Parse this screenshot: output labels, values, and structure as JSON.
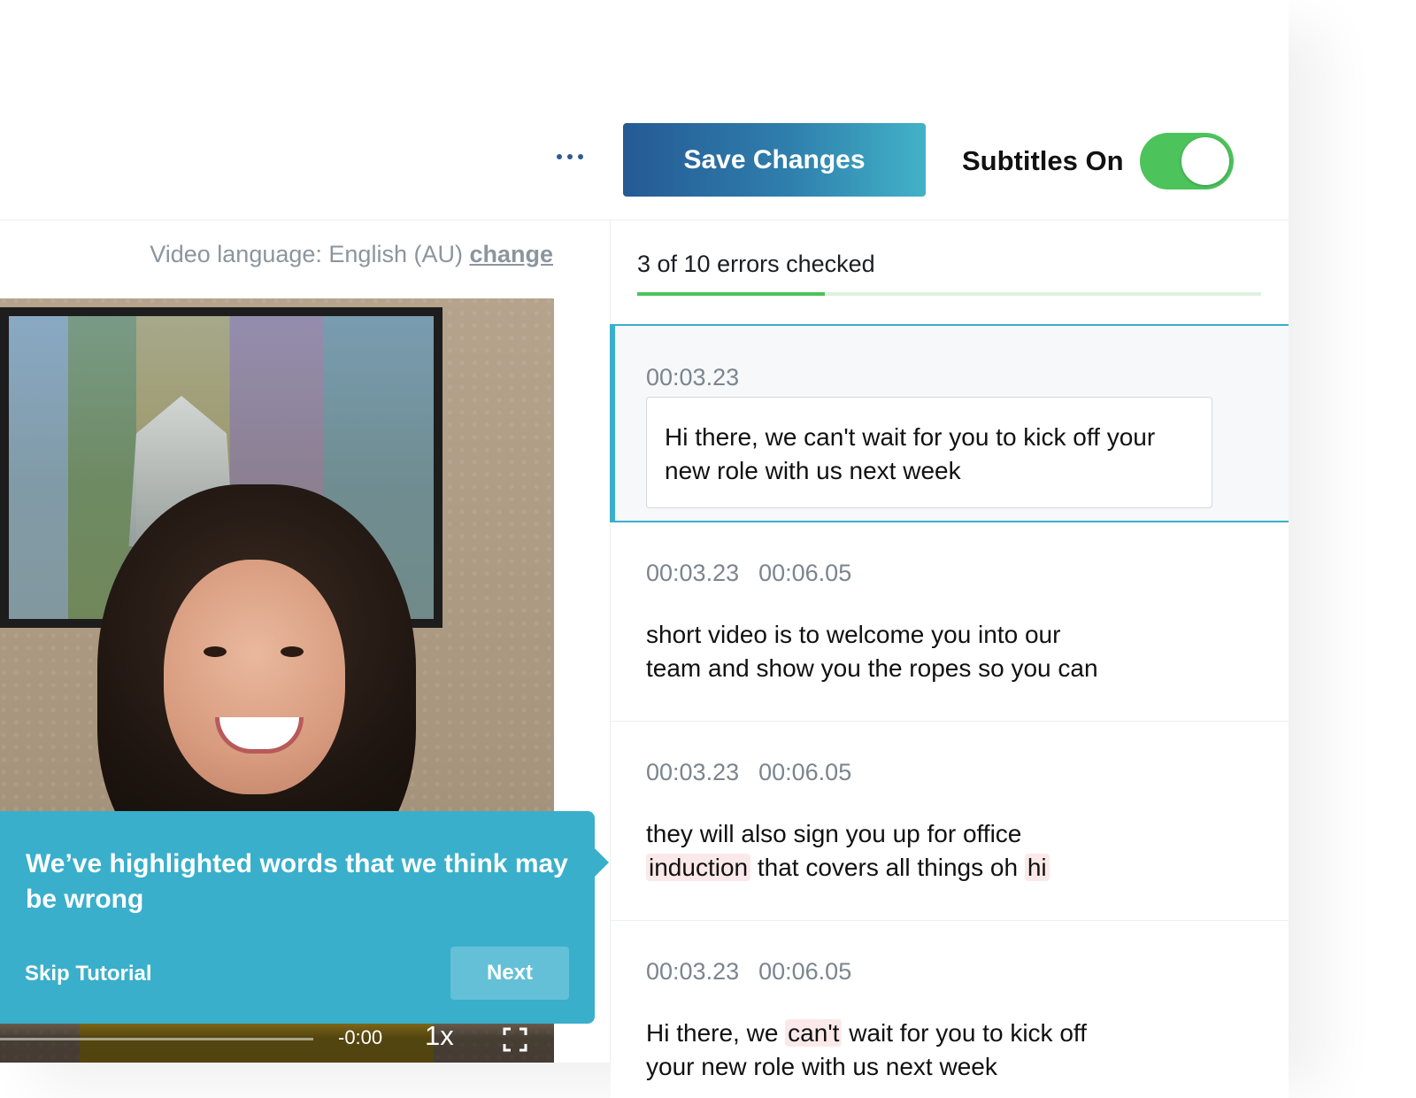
{
  "header": {
    "more_icon": "ellipsis-icon",
    "save_label": "Save Changes",
    "subtitles_label": "Subtitles On",
    "subtitles_on": true,
    "toggle_color": "#4cc35b"
  },
  "video": {
    "language_prefix": "Video language: English (AU)",
    "change_link": "change",
    "time": "-0:00",
    "speed": "1x",
    "fullscreen_icon": "fullscreen-icon"
  },
  "tooltip": {
    "text": "We’ve highlighted words that we think may be wrong",
    "skip_label": "Skip Tutorial",
    "next_label": "Next",
    "color": "#39afcc"
  },
  "progress": {
    "text": "3 of 10 errors checked",
    "checked": 3,
    "total": 10
  },
  "captions": [
    {
      "start": "00:03.23",
      "end": "",
      "text": "Hi there, we can't wait for you to kick off your new role with us next week"
    },
    {
      "start": "00:03.23",
      "end": "00:06.05",
      "text_line1": "short video is to welcome you into our",
      "text_line2": "team and show you the ropes so you can"
    },
    {
      "start": "00:03.23",
      "end": "00:06.05",
      "line1": "they will also sign you up for office",
      "hl1": "induction",
      "mid": " that covers all things oh ",
      "hl2": "hi"
    },
    {
      "start": "00:03.23",
      "end": "00:06.05",
      "pre": "Hi there, we ",
      "hl": "can't",
      "post": " wait for you to kick off",
      "line2": "your new role with us next week"
    }
  ],
  "highlight_color": "#fbe9e9"
}
